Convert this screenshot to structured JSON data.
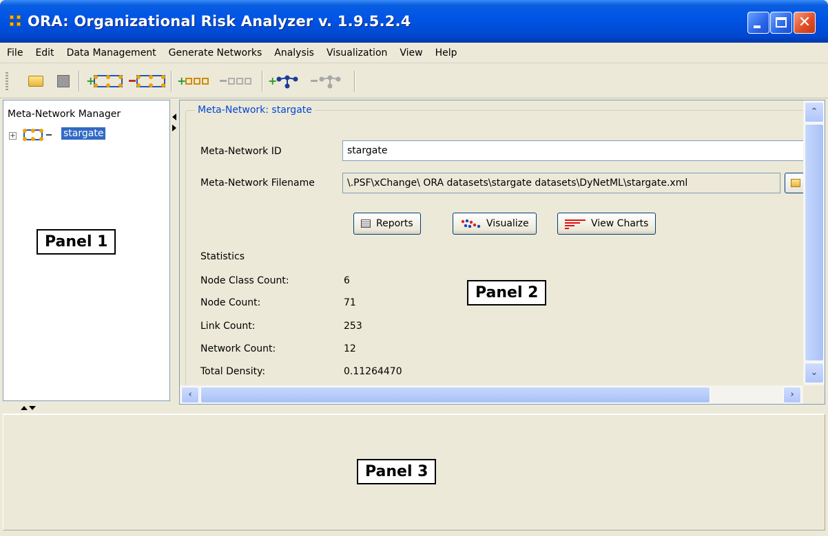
{
  "window": {
    "title": "ORA: Organizational Risk Analyzer v. 1.9.5.2.4",
    "close_glyph": "✕"
  },
  "menu": [
    "File",
    "Edit",
    "Data Management",
    "Generate Networks",
    "Analysis",
    "Visualization",
    "View",
    "Help"
  ],
  "toolbar": {
    "icons": [
      "open-folder-icon",
      "save-disk-icon",
      "add-metanetwork-icon",
      "remove-metanetwork-icon",
      "add-nodeset-icon",
      "remove-nodeset-icon",
      "add-network-icon",
      "remove-network-icon"
    ]
  },
  "panel1": {
    "title": "Meta-Network Manager",
    "tree_item": "stargate",
    "callout": "Panel 1"
  },
  "panel2": {
    "group_title": "Meta-Network: stargate",
    "id_label": "Meta-Network ID",
    "id_value": "stargate",
    "filename_label": "Meta-Network Filename",
    "filename_value": "\\.PSF\\xChange\\ ORA datasets\\stargate datasets\\DyNetML\\stargate.xml",
    "buttons": {
      "reports": "Reports",
      "visualize": "Visualize",
      "view_charts": "View Charts"
    },
    "statistics_title": "Statistics",
    "stats": [
      {
        "label": "Node Class Count:",
        "value": "6"
      },
      {
        "label": "Node Count:",
        "value": "71"
      },
      {
        "label": "Link Count:",
        "value": "253"
      },
      {
        "label": "Network Count:",
        "value": "12"
      },
      {
        "label": "Total Density:",
        "value": "0.11264470"
      }
    ],
    "callout": "Panel 2"
  },
  "panel3": {
    "callout": "Panel 3"
  },
  "colors": {
    "title_bar": "#0055e6",
    "selection": "#316ac5",
    "group_title": "#0046d5",
    "window_bg": "#ece9d8"
  }
}
